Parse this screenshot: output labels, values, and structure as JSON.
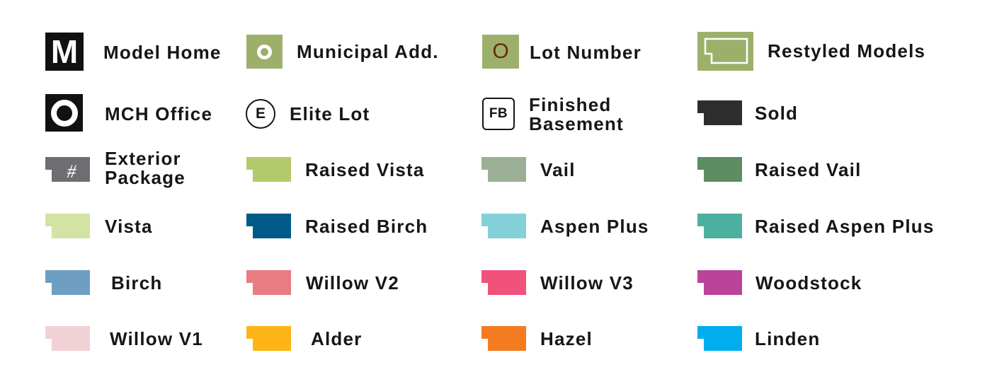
{
  "legend": {
    "symbols": [
      {
        "id": "model-home",
        "label": "Model Home",
        "glyph": "M",
        "icon": "model-home-icon",
        "bg": "#111111"
      },
      {
        "id": "municipal-add",
        "label": "Municipal Add.",
        "icon": "municipal-address-icon",
        "bg": "#9db06b"
      },
      {
        "id": "lot-number",
        "label": "Lot Number",
        "glyph": "O",
        "icon": "lot-number-icon",
        "bg": "#9db06b",
        "glyph_color": "#6b2414"
      },
      {
        "id": "restyled-models",
        "label": "Restyled Models",
        "icon": "restyled-lot-outline-icon",
        "bg": "#9db06b"
      },
      {
        "id": "mch-office",
        "label": "MCH Office",
        "icon": "office-ring-icon",
        "bg": "#111111"
      },
      {
        "id": "elite-lot",
        "label": "Elite Lot",
        "glyph": "E",
        "icon": "elite-circle-icon"
      },
      {
        "id": "finished-basement",
        "label_line1": "Finished",
        "label_line2": "Basement",
        "glyph": "FB",
        "icon": "finished-basement-icon"
      },
      {
        "id": "exterior-package",
        "label_line1": "Exterior",
        "label_line2": "Package",
        "glyph": "#",
        "icon": "exterior-package-icon",
        "color": "#6d6e71"
      }
    ],
    "swatches": [
      {
        "label": "Sold",
        "color": "#2e2d2e"
      },
      {
        "label": "Raised Vista",
        "color": "#b4c96c"
      },
      {
        "label": "Vail",
        "color": "#9baf97"
      },
      {
        "label": "Raised Vail",
        "color": "#5e8c61"
      },
      {
        "label": "Vista",
        "color": "#d2e3a4"
      },
      {
        "label": "Raised Birch",
        "color": "#005a87"
      },
      {
        "label": "Aspen Plus",
        "color": "#84d0d9"
      },
      {
        "label": "Raised Aspen Plus",
        "color": "#4cb09e"
      },
      {
        "label": "Birch",
        "color": "#6e9fc3"
      },
      {
        "label": "Willow V2",
        "color": "#e87c82"
      },
      {
        "label": "Willow V3",
        "color": "#f0527b"
      },
      {
        "label": "Woodstock",
        "color": "#b94499"
      },
      {
        "label": "Willow V1",
        "color": "#f1d0d6"
      },
      {
        "label": "Alder",
        "color": "#fdb515"
      },
      {
        "label": "Hazel",
        "color": "#f47b20"
      },
      {
        "label": "Linden",
        "color": "#00aeef"
      }
    ]
  }
}
